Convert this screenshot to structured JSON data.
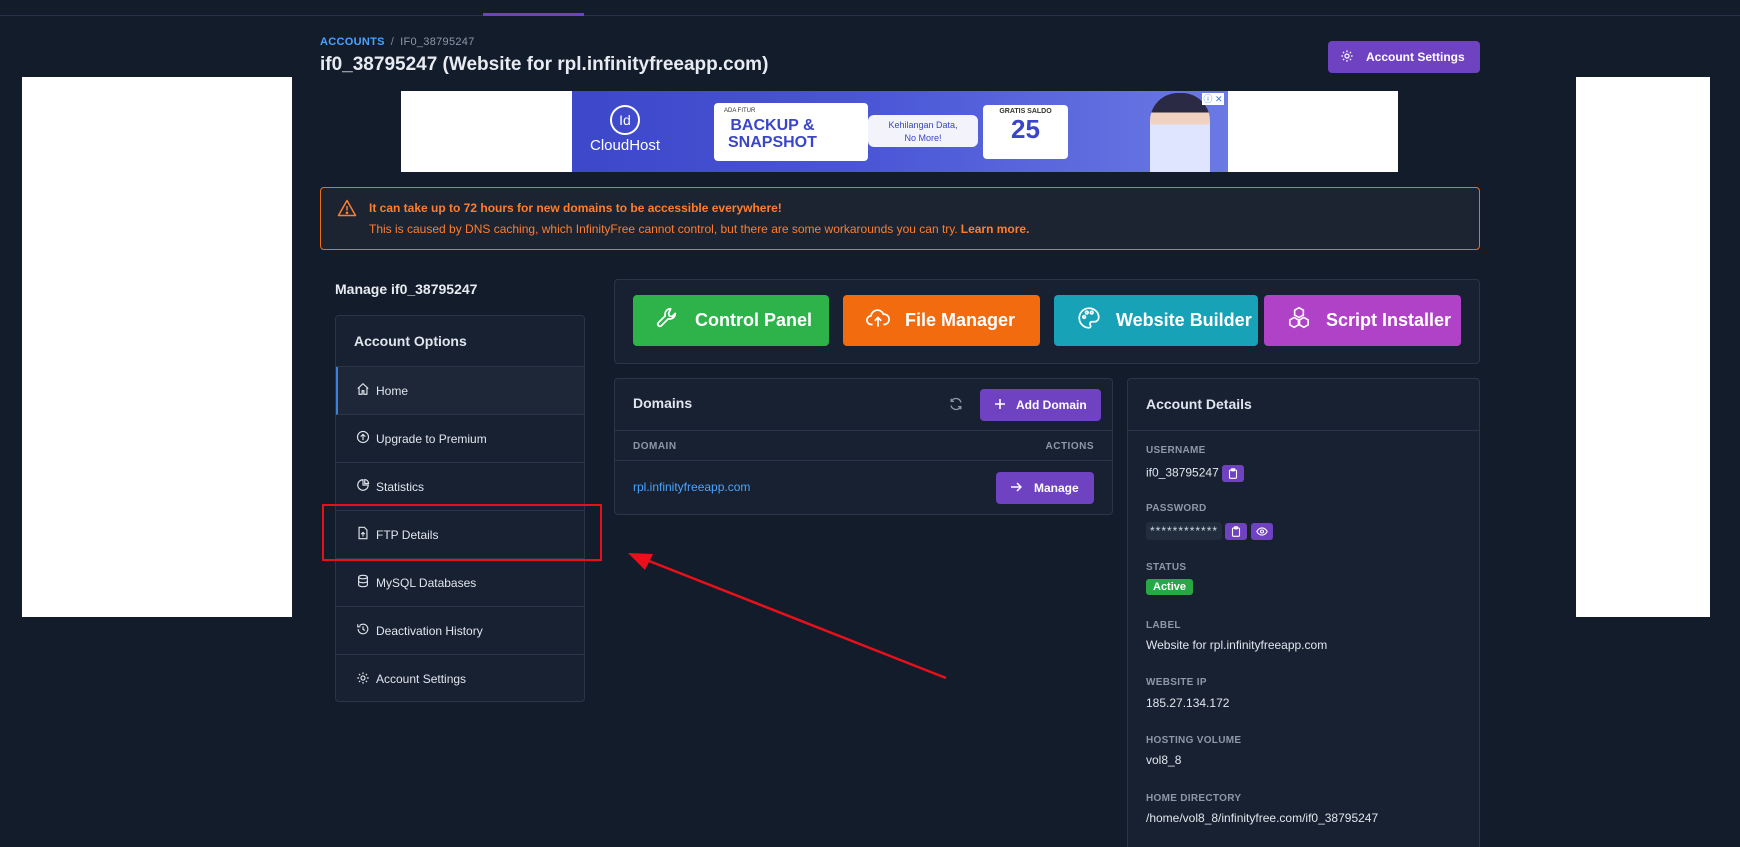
{
  "breadcrumb": {
    "root": "ACCOUNTS",
    "separator": "/",
    "current": "IF0_38795247"
  },
  "page": {
    "title": "if0_38795247 (Website for rpl.infinityfreeapp.com)"
  },
  "header": {
    "account_settings_label": "Account Settings"
  },
  "ad": {
    "logo_mark": "Id",
    "logo_name": "CloudHost",
    "card1_small": "ADA FITUR",
    "card1_big_line1": "BACKUP &",
    "card1_big_line2": "SNAPSHOT",
    "pill_line1": "Kehilangan Data,",
    "pill_line2": "No More!",
    "card2_small": "GRATIS SALDO",
    "card2_big": "25",
    "badge": "ⓘ ✕"
  },
  "alert": {
    "title": "It can take up to 72 hours for new domains to be accessible everywhere!",
    "body": "This is caused by DNS caching, which InfinityFree cannot control, but there are some workarounds you can try.",
    "link": "Learn more."
  },
  "sidebar": {
    "manage_title": "Manage if0_38795247",
    "header": "Account Options",
    "items": [
      {
        "label": "Home",
        "icon": "home-icon"
      },
      {
        "label": "Upgrade to Premium",
        "icon": "arrow-up-circle-icon"
      },
      {
        "label": "Statistics",
        "icon": "pie-chart-icon"
      },
      {
        "label": "FTP Details",
        "icon": "file-upload-icon"
      },
      {
        "label": "MySQL Databases",
        "icon": "database-icon"
      },
      {
        "label": "Deactivation History",
        "icon": "history-icon"
      },
      {
        "label": "Account Settings",
        "icon": "gear-icon"
      }
    ]
  },
  "launch": {
    "control_panel": "Control Panel",
    "file_manager": "File Manager",
    "website_builder": "Website Builder",
    "script_installer": "Script Installer"
  },
  "domains": {
    "title": "Domains",
    "add_label": "Add Domain",
    "col_domain": "DOMAIN",
    "col_actions": "ACTIONS",
    "rows": [
      {
        "domain": "rpl.infinityfreeapp.com",
        "action": "Manage"
      }
    ]
  },
  "details": {
    "title": "Account Details",
    "username_label": "USERNAME",
    "username": "if0_38795247",
    "password_label": "PASSWORD",
    "password_mask": "************",
    "status_label": "STATUS",
    "status": "Active",
    "label_label": "LABEL",
    "label_value": "Website for rpl.infinityfreeapp.com",
    "ip_label": "WEBSITE IP",
    "ip": "185.27.134.172",
    "volume_label": "HOSTING VOLUME",
    "volume": "vol8_8",
    "homedir_label": "HOME DIRECTORY",
    "homedir": "/home/vol8_8/infinityfree.com/if0_38795247"
  },
  "colors": {
    "background": "#131c2b",
    "card": "#182131",
    "accent_purple": "#6f42c1",
    "link_blue": "#4aa3ff",
    "alert_orange": "#f06d17",
    "control_panel_green": "#2db34a",
    "file_manager_orange": "#f26b0f",
    "website_builder_teal": "#17a2b8",
    "script_installer_magenta": "#b042c7",
    "annotation_red": "#e8101a"
  }
}
